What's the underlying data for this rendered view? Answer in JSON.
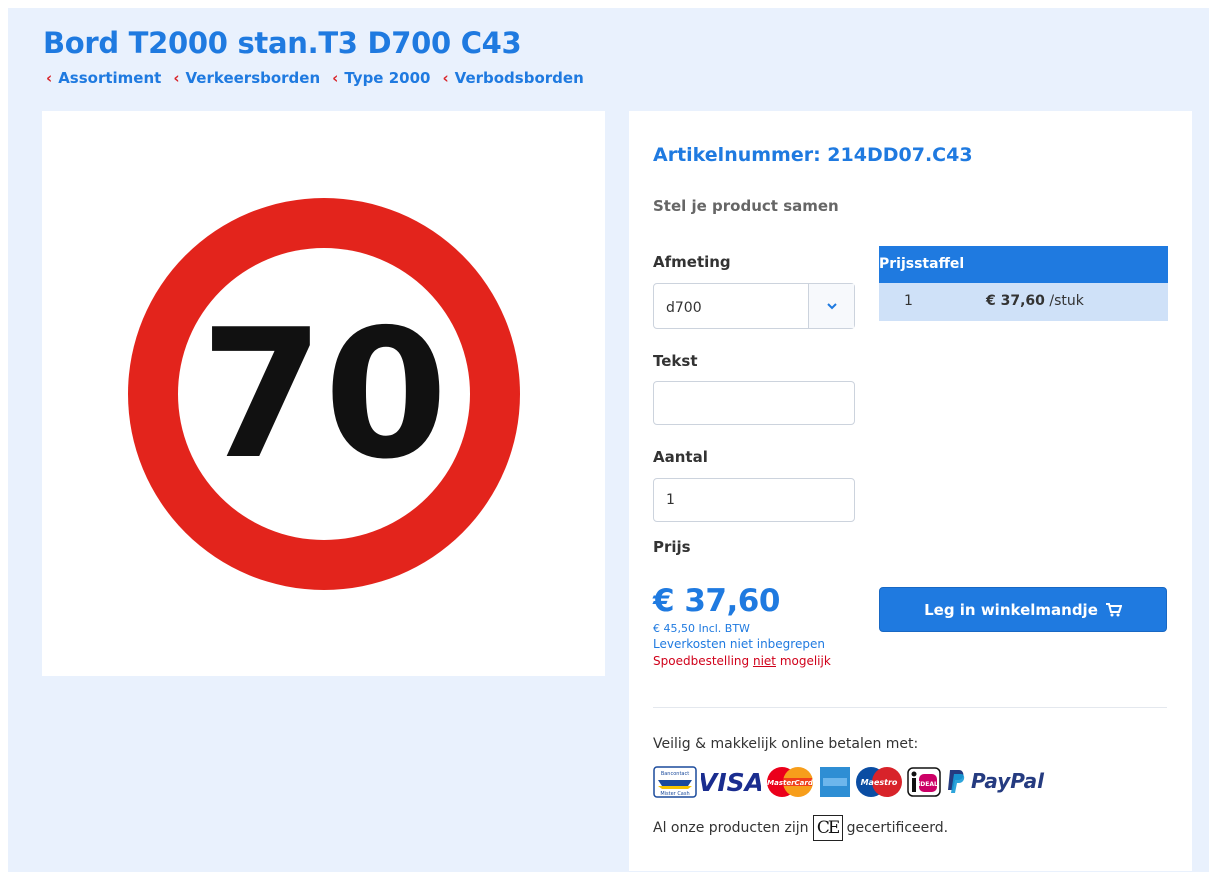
{
  "title": "Bord T2000 stan.T3 D700 C43",
  "breadcrumb": [
    "Assortiment",
    "Verkeersborden",
    "Type 2000",
    "Verbodsborden"
  ],
  "product_image": {
    "sign_number": "70"
  },
  "panel": {
    "artikelnummer": "Artikelnummer: 214DD07.C43",
    "compose_heading": "Stel je product samen",
    "afmeting_label": "Afmeting",
    "afmeting_value": "d700",
    "tekst_label": "Tekst",
    "tekst_value": "",
    "aantal_label": "Aantal",
    "aantal_value": "1",
    "prijs_label": "Prijs",
    "price": "€ 37,60",
    "price_incl": "€ 45,50 Incl. BTW",
    "delivery_note": "Leverkosten niet inbegrepen",
    "spoed_prefix": "Spoedbestelling ",
    "spoed_emph": "niet",
    "spoed_suffix": " mogelijk",
    "cart_button": "Leg in winkelmandje",
    "staffel": {
      "heading": "Prijsstaffel",
      "rows": [
        {
          "qty": "1",
          "price": "€ 37,60",
          "unit": " /stuk"
        }
      ]
    },
    "payment_text": "Veilig & makkelijk online betalen met:",
    "payment_logos": {
      "bancontact": [
        "Bancontact",
        "Mister Cash"
      ],
      "visa": "VISA",
      "mastercard": "MasterCard",
      "maestro": "Maestro",
      "ideal": "iDEAL",
      "paypal": "PayPal"
    },
    "ce_prefix": "Al onze producten zijn",
    "ce_mark": "CE",
    "ce_suffix": "gecertificeerd."
  },
  "colors": {
    "brand_blue": "#1f7ae0",
    "page_bg": "#e9f1fd",
    "sign_red": "#e3241c",
    "warning_red": "#d0021b"
  }
}
